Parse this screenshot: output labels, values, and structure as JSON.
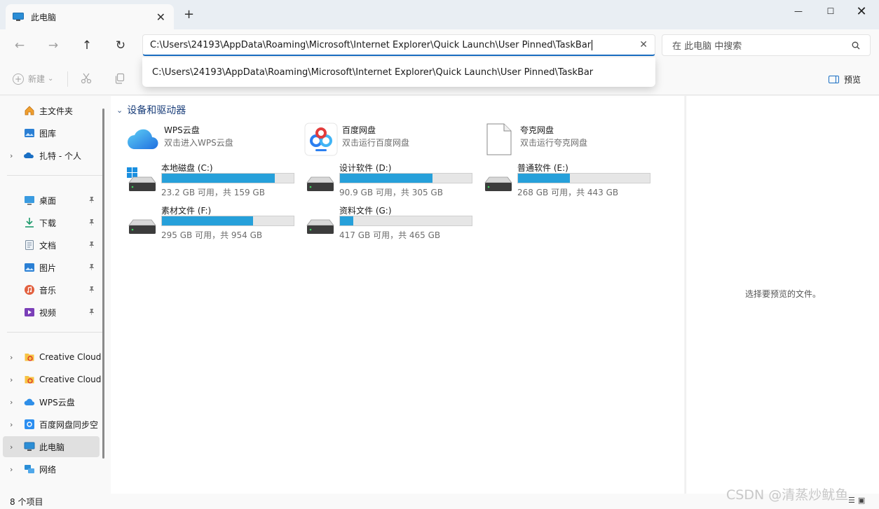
{
  "window": {
    "tab_title": "此电脑",
    "tab_close": "✕",
    "new_tab": "+",
    "minimize": "—",
    "maximize": "☐",
    "close": "✕"
  },
  "nav": {
    "back": "←",
    "forward": "→",
    "up": "↑",
    "refresh": "↻",
    "address_value": "C:\\Users\\24193\\AppData\\Roaming\\Microsoft\\Internet Explorer\\Quick Launch\\User Pinned\\TaskBar",
    "address_clear": "✕",
    "search_placeholder": "在 此电脑 中搜索",
    "suggestion": "C:\\Users\\24193\\AppData\\Roaming\\Microsoft\\Internet Explorer\\Quick Launch\\User Pinned\\TaskBar"
  },
  "toolbar": {
    "new_label": "新建",
    "new_chevron": "⌄",
    "preview_label": "预览"
  },
  "sidebar": {
    "items": [
      {
        "label": "主文件夹",
        "icon": "home-icon",
        "chevron": false,
        "pinned": false
      },
      {
        "label": "图库",
        "icon": "gallery-icon",
        "chevron": false,
        "pinned": false
      },
      {
        "label": "扎特 - 个人",
        "icon": "onedrive-icon",
        "chevron": true,
        "pinned": false
      },
      {
        "label": "桌面",
        "icon": "desktop-icon",
        "chevron": false,
        "pinned": true
      },
      {
        "label": "下载",
        "icon": "download-icon",
        "chevron": false,
        "pinned": true
      },
      {
        "label": "文档",
        "icon": "documents-icon",
        "chevron": false,
        "pinned": true
      },
      {
        "label": "图片",
        "icon": "pictures-icon",
        "chevron": false,
        "pinned": true
      },
      {
        "label": "音乐",
        "icon": "music-icon",
        "chevron": false,
        "pinned": true
      },
      {
        "label": "视频",
        "icon": "videos-icon",
        "chevron": false,
        "pinned": true
      },
      {
        "label": "Creative Cloud",
        "icon": "creative-cloud-icon",
        "chevron": true,
        "pinned": false
      },
      {
        "label": "Creative Cloud",
        "icon": "creative-cloud-icon",
        "chevron": true,
        "pinned": false
      },
      {
        "label": "WPS云盘",
        "icon": "wps-cloud-icon",
        "chevron": true,
        "pinned": false
      },
      {
        "label": "百度网盘同步空",
        "icon": "baidu-sync-icon",
        "chevron": true,
        "pinned": false
      },
      {
        "label": "此电脑",
        "icon": "this-pc-icon",
        "chevron": true,
        "pinned": false,
        "selected": true
      },
      {
        "label": "网络",
        "icon": "network-icon",
        "chevron": true,
        "pinned": false
      }
    ],
    "pin_glyph": "📌",
    "chevron_glyph": "›"
  },
  "main": {
    "group_title": "设备和驱动器",
    "group_chevron": "⌄",
    "tiles": [
      {
        "name": "WPS云盘",
        "sub": "双击进入WPS云盘",
        "icon": "wps-cloud-icon"
      },
      {
        "name": "百度网盘",
        "sub": "双击运行百度网盘",
        "icon": "baidu-netdisk-icon"
      },
      {
        "name": "夸克网盘",
        "sub": "双击运行夸克网盘",
        "icon": "blank-file-icon"
      }
    ],
    "drives": [
      {
        "name": "本地磁盘 (C:)",
        "free": "23.2 GB 可用，共 159 GB",
        "used_fraction": 0.854
      },
      {
        "name": "设计软件 (D:)",
        "free": "90.9 GB 可用，共 305 GB",
        "used_fraction": 0.702
      },
      {
        "name": "普通软件 (E:)",
        "free": "268 GB 可用，共 443 GB",
        "used_fraction": 0.395
      },
      {
        "name": "素材文件 (F:)",
        "free": "295 GB 可用，共 954 GB",
        "used_fraction": 0.691
      },
      {
        "name": "资料文件 (G:)",
        "free": "417 GB 可用，共 465 GB",
        "used_fraction": 0.103
      }
    ]
  },
  "preview": {
    "message": "选择要预览的文件。"
  },
  "status": {
    "item_count": "8 个项目"
  },
  "watermark": "CSDN @清蒸炒鱿鱼",
  "colors": {
    "accent": "#1a6fc4",
    "drive_fill": "#26a0da"
  }
}
